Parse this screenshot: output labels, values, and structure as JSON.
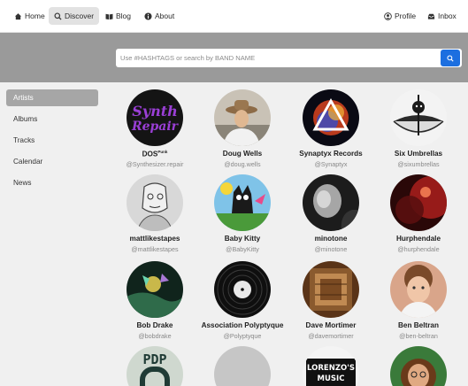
{
  "nav": {
    "home": "Home",
    "discover": "Discover",
    "blog": "Blog",
    "about": "About",
    "profile": "Profile",
    "inbox": "Inbox"
  },
  "search": {
    "placeholder": "Use #HASHTAGS or search by BAND NAME"
  },
  "sidebar": {
    "items": [
      {
        "label": "Artists",
        "active": true
      },
      {
        "label": "Albums"
      },
      {
        "label": "Tracks"
      },
      {
        "label": "Calendar"
      },
      {
        "label": "News"
      }
    ]
  },
  "artists": [
    {
      "name": "DOS",
      "name_sup": "Punk",
      "handle": "@Synthesizer.repair"
    },
    {
      "name": "Doug Wells",
      "handle": "@doug.wells"
    },
    {
      "name": "Synaptyx Records",
      "handle": "@Synaptyx"
    },
    {
      "name": "Six Umbrellas",
      "handle": "@sixumbrellas"
    },
    {
      "name": "mattlikestapes",
      "handle": "@mattlikestapes"
    },
    {
      "name": "Baby Kitty",
      "handle": "@BabyKitty"
    },
    {
      "name": "minotone",
      "handle": "@minotone"
    },
    {
      "name": "Hurphendale",
      "handle": "@hurphendale"
    },
    {
      "name": "Bob Drake",
      "handle": "@bobdrake"
    },
    {
      "name": "Association Polyptyque",
      "handle": "@Polyptyque"
    },
    {
      "name": "Dave Mortimer",
      "handle": "@davemortimer"
    },
    {
      "name": "Ben Beltran",
      "handle": "@ben-beltran"
    }
  ],
  "avatar_text": {
    "synth_line1": "Synth",
    "synth_line2": "Repair",
    "lorenzo_line1": "LORENZO'S",
    "lorenzo_line2": "MUSIC",
    "pdp": "PDP"
  },
  "colors": {
    "accent": "#1c6fe0",
    "banner": "#9a9a9a",
    "sidebar_active": "#a6a6a6"
  }
}
